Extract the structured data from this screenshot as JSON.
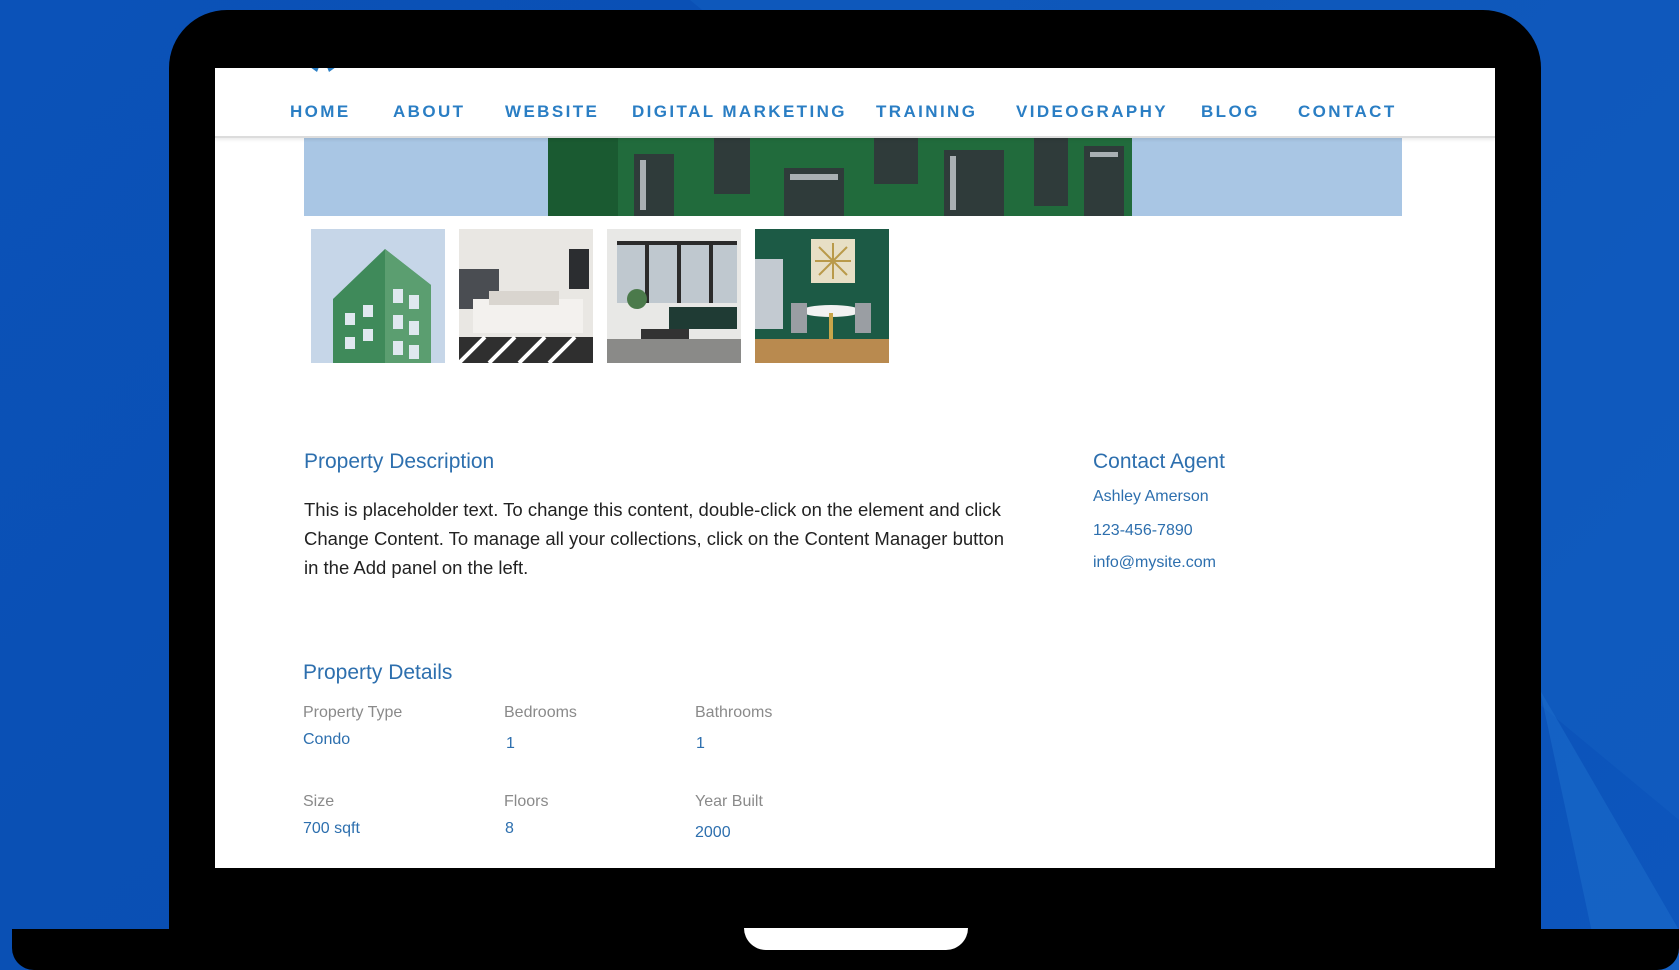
{
  "colors": {
    "background": "#0b52b8",
    "nav_link": "#2a7ec4",
    "heading": "#2d6fae",
    "body_text": "#222222",
    "label_text": "#8a8a8a"
  },
  "nav": {
    "items": [
      {
        "label": "HOME"
      },
      {
        "label": "ABOUT"
      },
      {
        "label": "WEBSITE"
      },
      {
        "label": "DIGITAL MARKETING"
      },
      {
        "label": "TRAINING"
      },
      {
        "label": "VIDEOGRAPHY"
      },
      {
        "label": "BLOG"
      },
      {
        "label": "CONTACT"
      }
    ]
  },
  "gallery": {
    "thumbnails": [
      {
        "subject": "building-exterior"
      },
      {
        "subject": "bedroom"
      },
      {
        "subject": "living-room"
      },
      {
        "subject": "dining-room"
      }
    ]
  },
  "description": {
    "title": "Property Description",
    "body": "This is placeholder text. To change this content, double-click on the element and click Change Content. To manage all your collections, click on the Content Manager button in the Add panel on the left."
  },
  "agent": {
    "title": "Contact Agent",
    "name": "Ashley Amerson",
    "phone": "123-456-7890",
    "email": "info@mysite.com"
  },
  "details": {
    "title": "Property Details",
    "property_type": {
      "label": "Property Type",
      "value": "Condo"
    },
    "bedrooms": {
      "label": "Bedrooms",
      "value": "1"
    },
    "bathrooms": {
      "label": "Bathrooms",
      "value": "1"
    },
    "size": {
      "label": "Size",
      "value": "700 sqft"
    },
    "floors": {
      "label": "Floors",
      "value": "8"
    },
    "year_built": {
      "label": "Year Built",
      "value": "2000"
    }
  }
}
